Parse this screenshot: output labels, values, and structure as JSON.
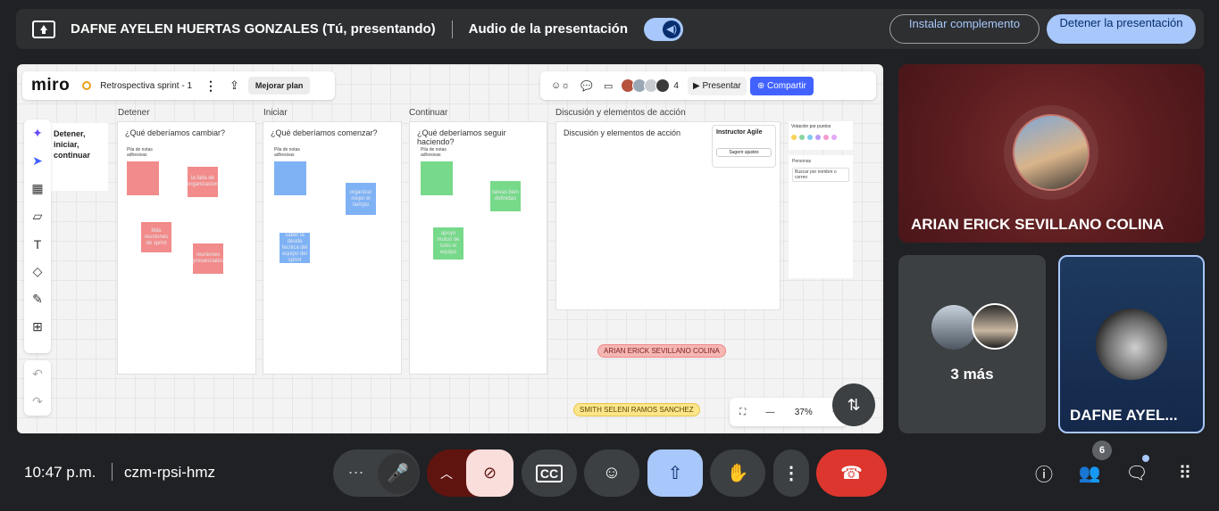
{
  "banner": {
    "presenter_text": "DAFNE AYELEN HUERTAS GONZALES (Tú, presentando)",
    "audio_label": "Audio de la presentación",
    "install_button": "Instalar complemento",
    "stop_button": "Detener la presentación"
  },
  "miro": {
    "logo": "miro",
    "board_name": "Retrospectiva sprint - 1",
    "upgrade_button": "Mejorar plan",
    "collaborator_count": "4",
    "present_button": "Presentar",
    "share_button": "Compartir",
    "side_frame_title": "Detener, iniciar, continuar",
    "columns": [
      {
        "label": "Detener",
        "question": "¿Qué deberíamos cambiar?"
      },
      {
        "label": "Iniciar",
        "question": "¿Qué deberíamos comenzar?"
      },
      {
        "label": "Continuar",
        "question": "¿Qué deberíamos seguir haciendo?"
      },
      {
        "label": "Discusión y elementos de acción",
        "question": "Discusión y elementos de acción"
      }
    ],
    "pile_label": "Pila de notas adhesivas",
    "stickies": {
      "detener": [
        "la falta de organizacion",
        "Más reuniones de sprint",
        "reuniones presenciales"
      ],
      "iniciar": [
        "organizar mejor el tiempo",
        "saber la deuda tecnica del equipo del sprint"
      ],
      "continuar": [
        "tareas bien definidas",
        "apoyo mutuo de todo el equipo"
      ]
    },
    "agile_title": "Instructor Agile",
    "agile_button": "Sugerir ajustes",
    "vote_title": "Votación por puntos",
    "persons_title": "Personas",
    "persons_search": "Buscar por nombre o correo",
    "cursor_1": "ARIAN ERICK SEVILLANO COLINA",
    "cursor_2": "SMITH SELENI RAMOS SANCHEZ",
    "zoom": "37%"
  },
  "tiles": {
    "arian": "ARIAN ERICK SEVILLANO COLINA",
    "more": "3 más",
    "dafne": "DAFNE AYEL..."
  },
  "footer": {
    "time": "10:47 p.m.",
    "meeting_code": "czm-rpsi-hmz",
    "participants_badge": "6"
  },
  "colors": {
    "red_sticky": "#f28b8b",
    "blue_sticky": "#7fb2f5",
    "green_sticky": "#77d98a",
    "accent": "#a8c7fa",
    "end_call": "#dc362e"
  }
}
